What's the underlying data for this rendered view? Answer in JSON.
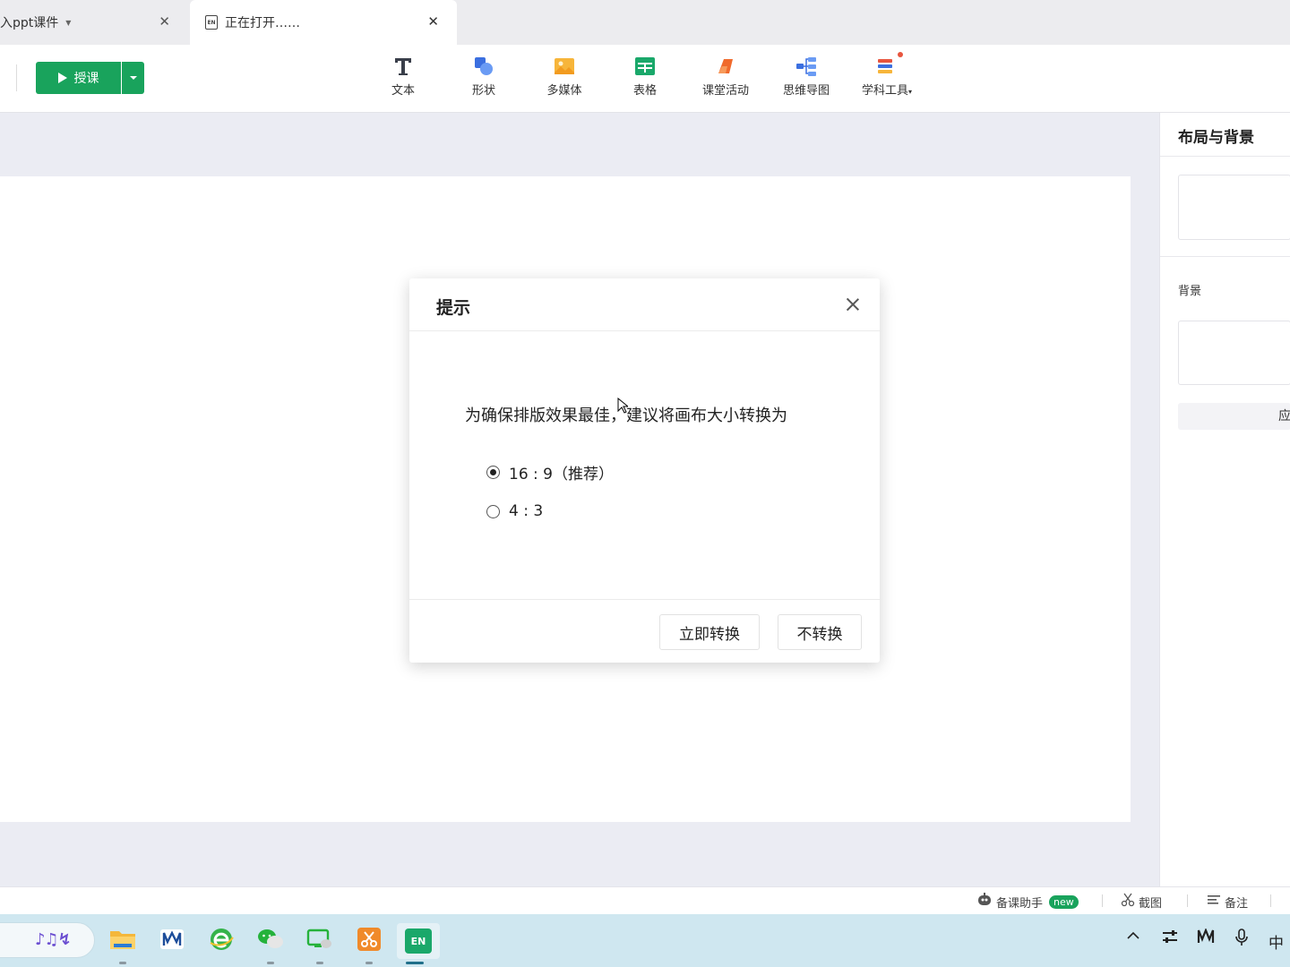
{
  "tabs": [
    {
      "label": "入ppt课件",
      "close": "✕"
    },
    {
      "label": "正在打开……",
      "icon": "EN",
      "close": "✕"
    }
  ],
  "toolbar": {
    "teach_label": "授课",
    "tools": [
      {
        "label": "文本",
        "icon": "text-icon"
      },
      {
        "label": "形状",
        "icon": "shape-icon"
      },
      {
        "label": "多媒体",
        "icon": "media-icon"
      },
      {
        "label": "表格",
        "icon": "table-icon"
      },
      {
        "label": "课堂活动",
        "icon": "activity-icon"
      },
      {
        "label": "思维导图",
        "icon": "mindmap-icon"
      },
      {
        "label": "学科工具",
        "icon": "subject-tools-icon",
        "caret": "▾"
      }
    ]
  },
  "right_panel": {
    "title": "布局与背景",
    "background_label": "背景",
    "apply_label": "应"
  },
  "dialog": {
    "title": "提示",
    "message": "为确保排版效果最佳，建议将画布大小转换为",
    "options": [
      {
        "label": "16 : 9（推荐）",
        "selected": true
      },
      {
        "label": "4 : 3",
        "selected": false
      }
    ],
    "convert_label": "立即转换",
    "no_convert_label": "不转换"
  },
  "statusbar": {
    "assistant_label": "备课助手",
    "assistant_badge": "new",
    "screenshot_label": "截图",
    "notes_label": "备注"
  },
  "taskbar": {
    "ime_label": "中",
    "active_app_label": "EN"
  },
  "colors": {
    "accent_green": "#19a35c",
    "taskbar_bg": "#cfe7f0"
  }
}
